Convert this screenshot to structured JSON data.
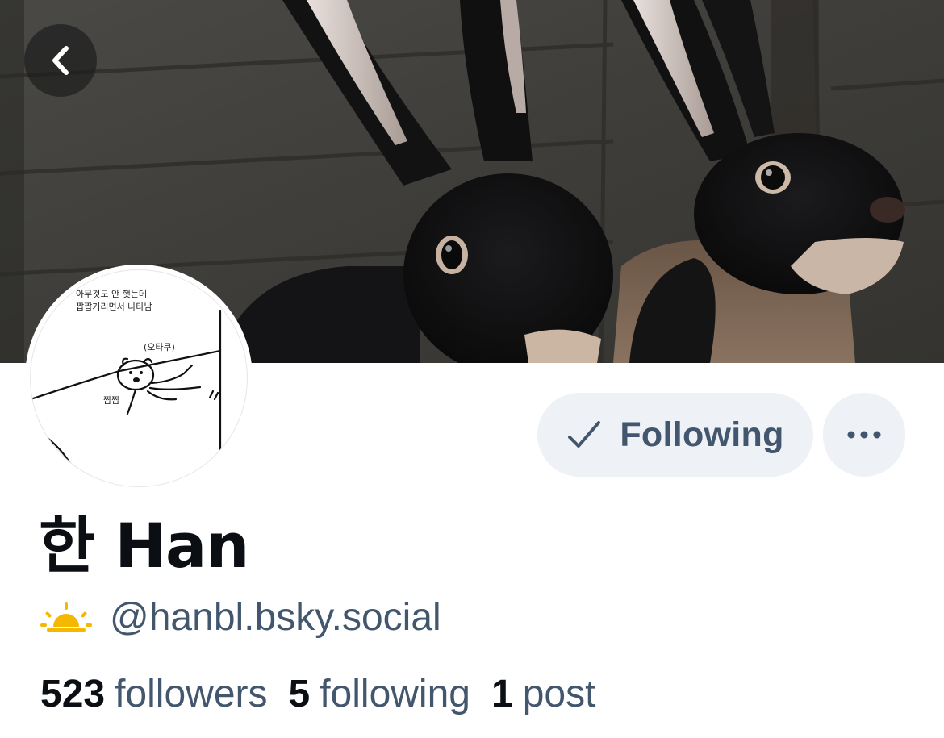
{
  "header": {
    "back_icon": "chevron-left-icon",
    "banner_alt_icon": "two-black-rabbits-photo"
  },
  "avatar": {
    "line1": "아무것도 안 햇는데",
    "line2": "짭짭거리면서 나타남",
    "bubble": "(오타쿠)",
    "sound": "짭짭"
  },
  "actions": {
    "following_label": "Following",
    "check_icon": "checkmark-icon",
    "more_icon": "ellipsis-icon"
  },
  "profile": {
    "display_name": "한 Han",
    "handle_icon": "sunrise-icon",
    "handle": "@hanbl.bsky.social"
  },
  "stats": {
    "followers_count": "523",
    "followers_label": "followers",
    "following_count": "5",
    "following_label": "following",
    "posts_count": "1",
    "posts_label": "post"
  },
  "colors": {
    "button_bg": "#eef1f5",
    "secondary_text": "#42566e",
    "primary_text": "#0b0f14",
    "sun": "#f5b800"
  }
}
